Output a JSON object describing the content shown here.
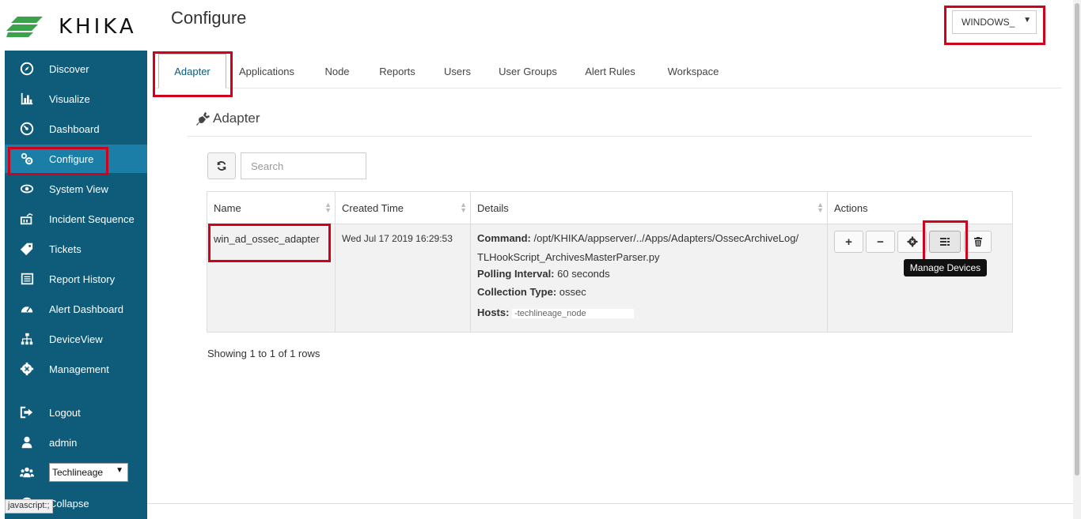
{
  "logo": {
    "text": "KHIKA"
  },
  "header": {
    "title": "Configure",
    "env_select": {
      "value": "WINDOWS_",
      "caret": "▼"
    }
  },
  "sidebar": {
    "items": [
      {
        "label": "Discover",
        "icon": "compass-icon"
      },
      {
        "label": "Visualize",
        "icon": "bar-chart-icon"
      },
      {
        "label": "Dashboard",
        "icon": "dashboard-icon"
      },
      {
        "label": "Configure",
        "icon": "cogs-icon",
        "active": true
      },
      {
        "label": "System View",
        "icon": "eye-icon"
      },
      {
        "label": "Incident Sequence",
        "icon": "sequence-icon"
      },
      {
        "label": "Tickets",
        "icon": "tag-icon"
      },
      {
        "label": "Report History",
        "icon": "list-icon"
      },
      {
        "label": "Alert Dashboard",
        "icon": "gauge-icon"
      },
      {
        "label": "DeviceView",
        "icon": "sitemap-icon"
      },
      {
        "label": "Management",
        "icon": "gear-icon"
      },
      {
        "label": "Logout",
        "icon": "sign-out-icon"
      },
      {
        "label": "admin",
        "icon": "user-icon"
      },
      {
        "label": "Collapse",
        "icon": "collapse-icon"
      }
    ],
    "org_select": {
      "value": "Techlineage",
      "caret": "▼"
    }
  },
  "tabs": [
    "Adapter",
    "Applications",
    "Node",
    "Reports",
    "Users",
    "User Groups",
    "Alert Rules",
    "Workspace"
  ],
  "active_tab": "Adapter",
  "section": {
    "title": "Adapter"
  },
  "toolbar": {
    "search_placeholder": "Search"
  },
  "table": {
    "columns": [
      "Name",
      "Created Time",
      "Details",
      "Actions"
    ],
    "rows": [
      {
        "name": "win_ad_ossec_adapter",
        "created": "Wed Jul 17 2019 16:29:53",
        "command_label": "Command:",
        "command_value": "/opt/KHIKA/appserver/../Apps/Adapters/OssecArchiveLog/",
        "command_value_2": "TLHookScript_ArchivesMasterParser.py",
        "polling_label": "Polling Interval:",
        "polling_value": "60 seconds",
        "collection_label": "Collection Type:",
        "collection_value": "ossec",
        "hosts_label": "Hosts:",
        "hosts_value": "-techlineage_node"
      }
    ],
    "actions": {
      "add": "+",
      "remove": "−",
      "tooltip": "Manage Devices"
    }
  },
  "pagination": {
    "text": "Showing 1 to 1 of 1 rows"
  },
  "status_tip": "javascript:;",
  "colors": {
    "sidebar_bg": "#0e5b7a",
    "active_bg": "#1a7ea6",
    "highlight": "#d0021b"
  }
}
